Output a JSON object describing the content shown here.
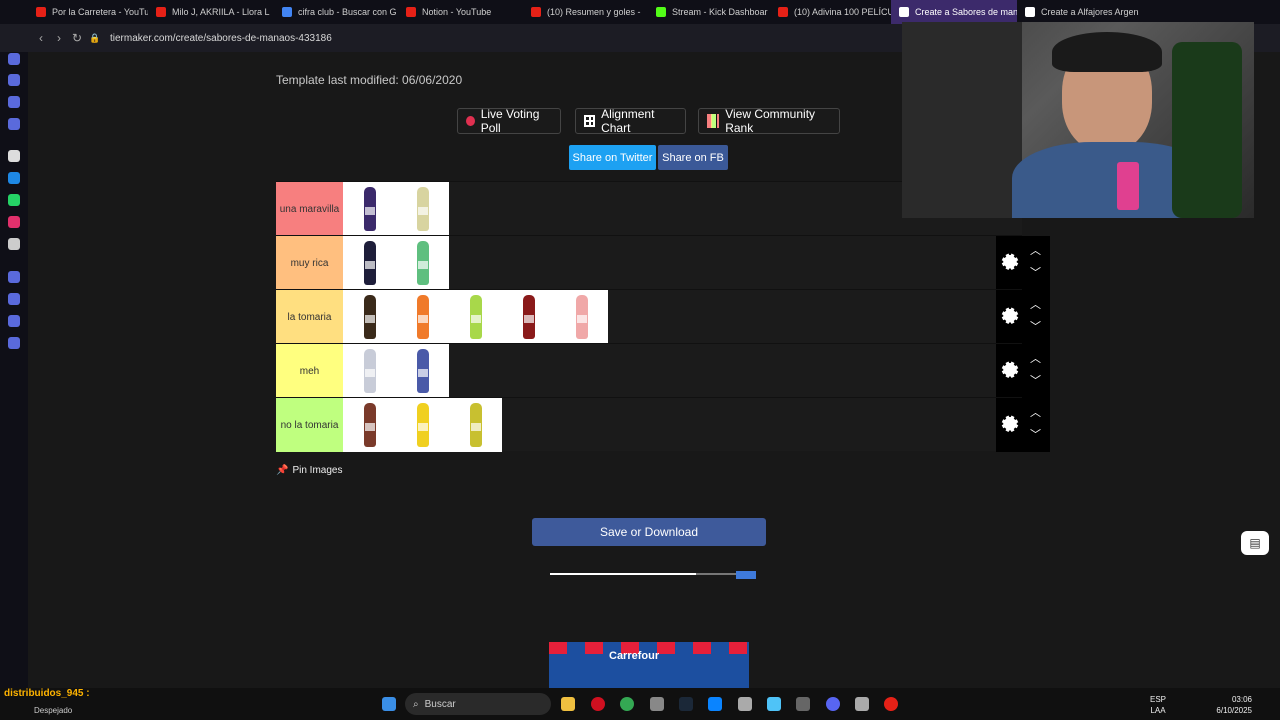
{
  "browser": {
    "tabs": [
      {
        "label": "Por la Carretera - YouTu",
        "icon": "youtube-icon",
        "color": "#e62117"
      },
      {
        "label": "Milo J, AKRIILA - Llora L",
        "icon": "youtube-icon",
        "color": "#e62117"
      },
      {
        "label": "cifra club - Buscar con G",
        "icon": "google-icon",
        "color": "#4285f4"
      },
      {
        "label": "Notion - YouTube",
        "icon": "youtube-icon",
        "color": "#e62117"
      },
      {
        "label": "(10) Resumen y goles -",
        "icon": "youtube-icon",
        "color": "#e62117"
      },
      {
        "label": "Stream - Kick Dashboar",
        "icon": "kick-icon",
        "color": "#53fc18"
      },
      {
        "label": "(10) Adivina 100 PELÍCU",
        "icon": "youtube-icon",
        "color": "#e62117"
      },
      {
        "label": "Create a Sabores de man",
        "icon": "tiermaker-icon",
        "color": "#ffffff",
        "active": true
      },
      {
        "label": "Create a Alfajores Argen",
        "icon": "tiermaker-icon",
        "color": "#ffffff"
      }
    ],
    "url": "tiermaker.com/create/sabores-de-manaos-433186"
  },
  "page": {
    "modified": "Template last modified: 06/06/2020",
    "buttons": {
      "live_voting": "Live Voting Poll",
      "alignment_chart": "Alignment Chart",
      "community_rank": "View Community Rank",
      "share_twitter": "Share on Twitter",
      "share_fb": "Share on FB"
    },
    "tiers": [
      {
        "label": "una maravilla",
        "color": "#f77f7f",
        "items": [
          "#3b2a6b",
          "#d8d4a0"
        ]
      },
      {
        "label": "muy rica",
        "color": "#ffbf7f",
        "items": [
          "#1e1e3a",
          "#5fbf7f"
        ]
      },
      {
        "label": "la tomaria",
        "color": "#ffdf80",
        "items": [
          "#3a2a1a",
          "#f07a2a",
          "#a8d84a",
          "#8a1a1a",
          "#f0a8a8"
        ]
      },
      {
        "label": "meh",
        "color": "#ffff7f",
        "items": [
          "#c8ccd8",
          "#4a5aa8"
        ]
      },
      {
        "label": "no la tomaria",
        "color": "#bfff7f",
        "items": [
          "#7a3a2a",
          "#f0d020",
          "#c8c030"
        ]
      }
    ],
    "pin_label": "Pin Images",
    "save_label": "Save or Download",
    "ad_text": "Carrefour"
  },
  "taskbar": {
    "weather_user": "distribuidos_945 :",
    "weather_status": "Despejado",
    "search_label": "Buscar",
    "lang_top": "ESP",
    "lang_bottom": "LAA",
    "time": "03:06",
    "date": "6/10/2025"
  }
}
